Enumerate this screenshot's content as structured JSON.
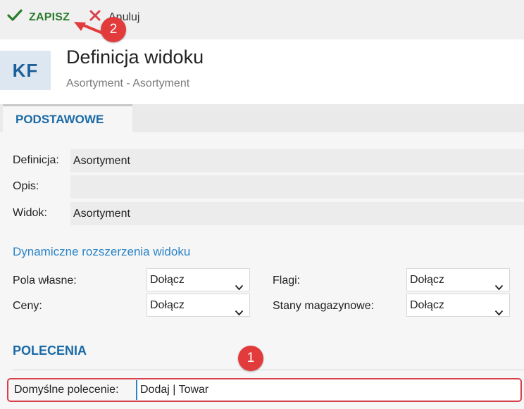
{
  "toolbar": {
    "save_label": "ZAPISZ",
    "cancel_label": "Anuluj"
  },
  "header": {
    "avatar_initials": "KF",
    "title": "Definicja widoku",
    "subtitle": "Asortyment - Asortyment"
  },
  "tabs": [
    {
      "label": "PODSTAWOWE",
      "active": true
    }
  ],
  "fields": {
    "definicja": {
      "label": "Definicja:",
      "value": "Asortyment"
    },
    "opis": {
      "label": "Opis:",
      "value": ""
    },
    "widok": {
      "label": "Widok:",
      "value": "Asortyment"
    }
  },
  "extensions": {
    "heading": "Dynamiczne rozszerzenia widoku",
    "pola_wlasne": {
      "label": "Pola własne:",
      "value": "Dołącz"
    },
    "flagi": {
      "label": "Flagi:",
      "value": "Dołącz"
    },
    "ceny": {
      "label": "Ceny:",
      "value": "Dołącz"
    },
    "stany": {
      "label": "Stany magazynowe:",
      "value": "Dołącz"
    }
  },
  "commands": {
    "heading": "POLECENIA",
    "default_label": "Domyślne polecenie:",
    "default_value": "Dodaj | Towar"
  },
  "annotations": {
    "badge_1": "1",
    "badge_2": "2"
  },
  "colors": {
    "save_green": "#2d7d2d",
    "cancel_red": "#d9404a",
    "accent_blue": "#1a6aa6",
    "annotation_red": "#e23b3b"
  }
}
